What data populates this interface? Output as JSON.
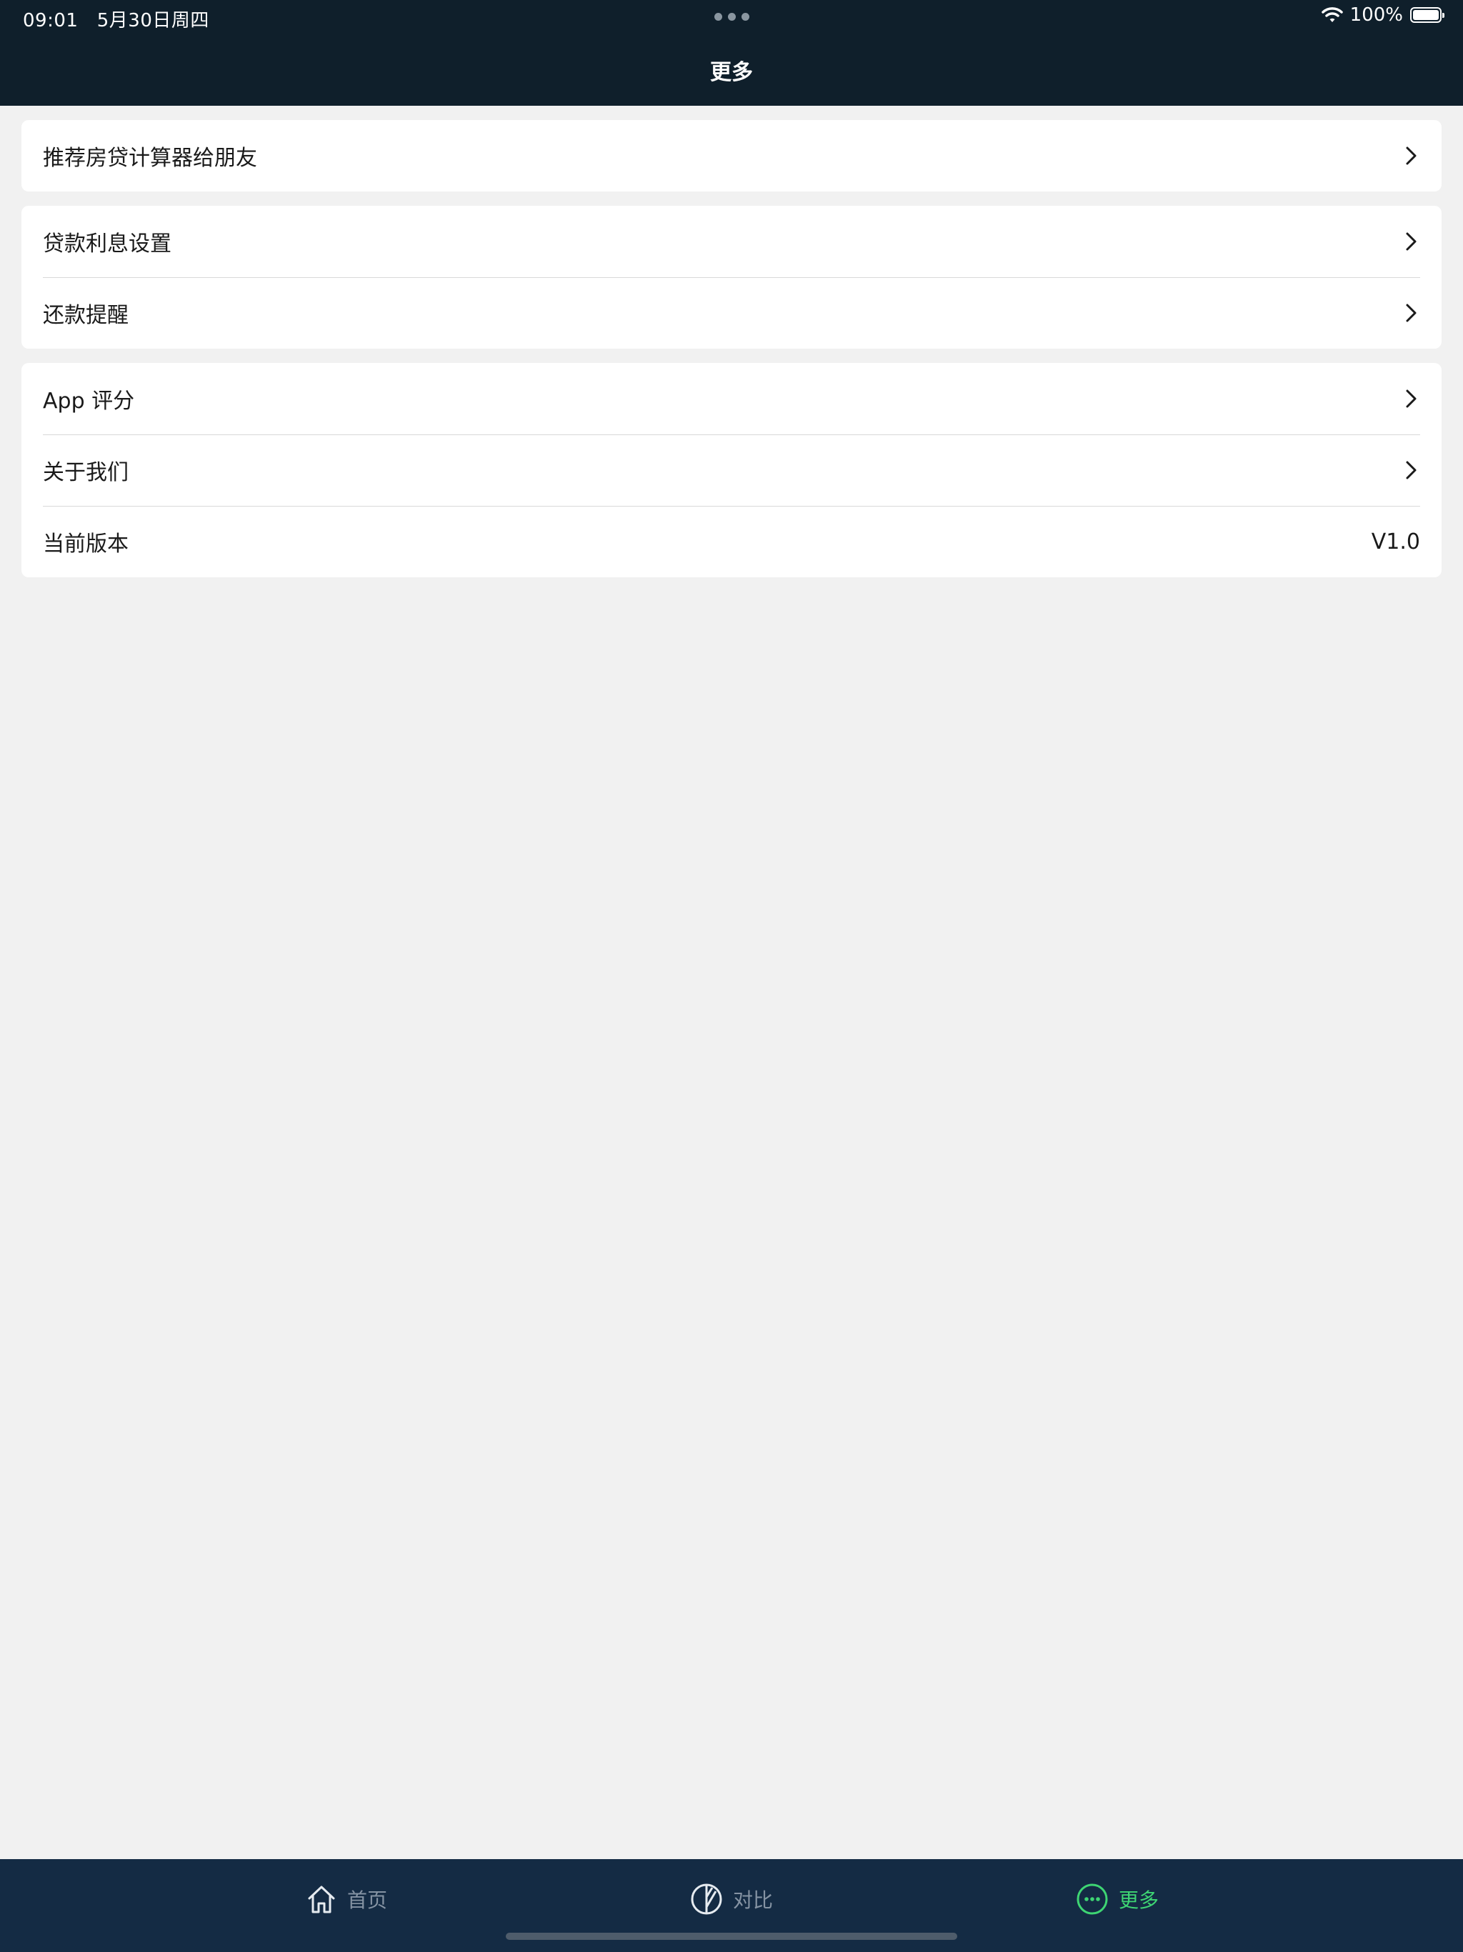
{
  "status_bar": {
    "time": "09:01",
    "date": "5月30日周四",
    "battery": "100%"
  },
  "nav": {
    "title": "更多"
  },
  "groups": [
    {
      "items": [
        {
          "label": "推荐房贷计算器给朋友"
        }
      ]
    },
    {
      "items": [
        {
          "label": "贷款利息设置"
        },
        {
          "label": "还款提醒"
        }
      ]
    },
    {
      "items": [
        {
          "label": "App 评分"
        },
        {
          "label": "关于我们"
        },
        {
          "label": "当前版本",
          "value": "V1.0"
        }
      ]
    }
  ],
  "tabbar": {
    "tabs": [
      {
        "label": "首页",
        "icon": "home-icon"
      },
      {
        "label": "对比",
        "icon": "compare-icon"
      },
      {
        "label": "更多",
        "icon": "more-icon",
        "active": true
      }
    ],
    "active_color": "#3ed573",
    "inactive_color": "#8593a3"
  },
  "colors": {
    "header_bg": "#0f1f2b",
    "tabbar_bg": "#142b44",
    "page_bg": "#f1f1f1"
  }
}
